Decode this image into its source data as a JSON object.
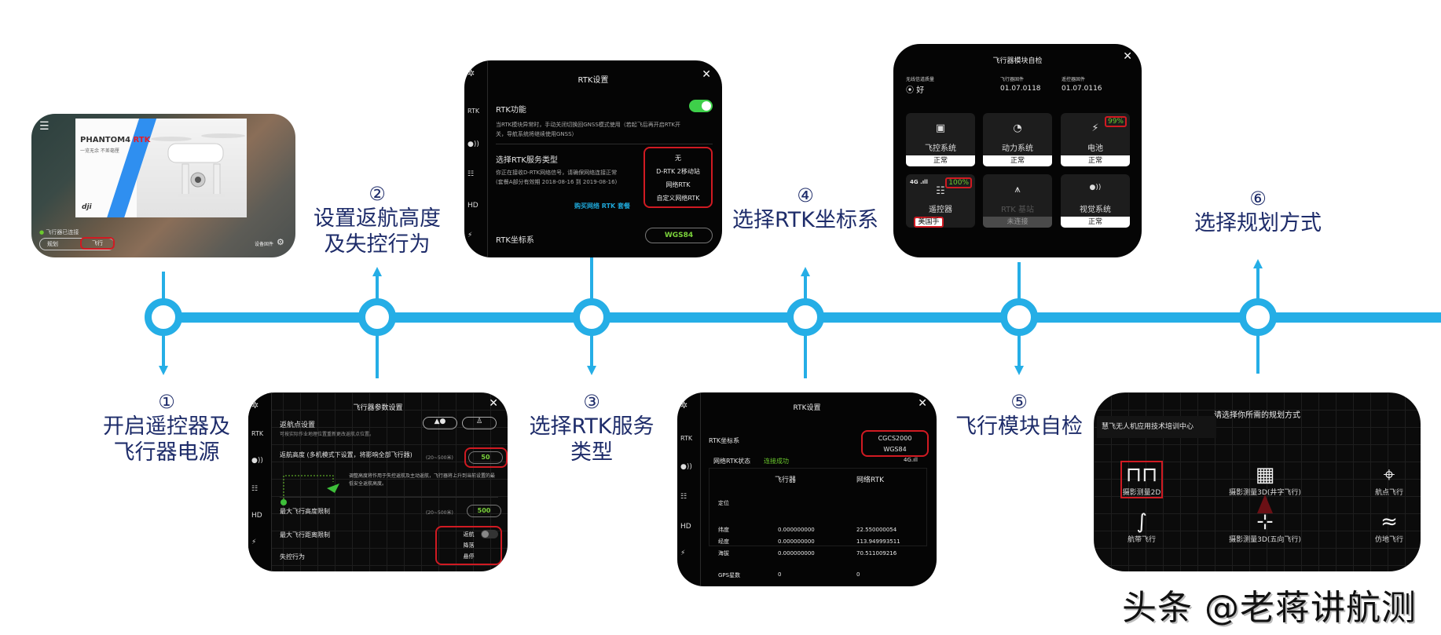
{
  "colors": {
    "timeline": "#25aee6",
    "label": "#1e2c6a",
    "highlight": "#d01a22",
    "accent_green": "#6ccb2d"
  },
  "steps": [
    {
      "num": "①",
      "line1": "开启遥控器及",
      "line2": "飞行器电源"
    },
    {
      "num": "②",
      "line1": "设置返航高度",
      "line2": "及失控行为"
    },
    {
      "num": "③",
      "line1": "选择RTK服务",
      "line2": "类型"
    },
    {
      "num": "④",
      "line1": "选择RTK坐标系",
      "line2": ""
    },
    {
      "num": "⑤",
      "line1": "飞行模块自检",
      "line2": ""
    },
    {
      "num": "⑥",
      "line1": "选择规划方式",
      "line2": ""
    }
  ],
  "screen_start": {
    "menu_icon": "menu-icon",
    "brand": "PHANTOM4",
    "brand_accent": "RTK",
    "slogan": "一览无余 不差毫厘",
    "logo": "dji",
    "status": "飞行器已连接",
    "btn_plan": "规划",
    "btn_fly": "飞行",
    "device_firmware": "设备固件"
  },
  "screen_rtk_service": {
    "title": "RTK设置",
    "close": "✕",
    "side": [
      "RTK",
      "HD"
    ],
    "rtk_function_label": "RTK功能",
    "rtk_function_on": true,
    "rtk_desc": "当RTK模块异常时，手动关闭切换回GNSS模式使用（若起飞后再开启RTK开关，导航系统将继续使用GNSS）",
    "service_type_label": "选择RTK服务类型",
    "service_desc_1": "你正在接收D-RTK网络信号，请确保网络连接正常",
    "service_desc_2": "(套餐A部分有效期 2018-08-16 到 2019-08-16)",
    "buy_link": "购买网络 RTK 套餐",
    "service_options": [
      "无",
      "D-RTK 2移动站",
      "网络RTK",
      "自定义网络RTK"
    ],
    "coord_label": "RTK坐标系",
    "coord_value": "WGS84"
  },
  "screen_params": {
    "title": "飞行器参数设置",
    "close": "✕",
    "side": [
      "RTK",
      "HD"
    ],
    "home_label": "返航点设置",
    "home_desc": "可按实际作业地理位置重新更改返航点位置。",
    "rth_height_label": "返航高度 (多机模式下设置，将影响全部飞行器)",
    "rth_range": "(20~500米)",
    "rth_value": "50",
    "rth_desc": "调整高度将作用于失控返航及主动返航，飞行器将上升到当前设置的最低安全返航高度。",
    "max_alt_label": "最大飞行高度限制",
    "max_alt_range": "(20~500米)",
    "max_alt_value": "500",
    "max_dist_label": "最大飞行距离限制",
    "lost_label": "失控行为",
    "lost_options": [
      "返航",
      "降落",
      "悬停"
    ]
  },
  "screen_rtk_coord": {
    "title": "RTK设置",
    "close": "✕",
    "side": [
      "RTK",
      "HD"
    ],
    "coord_label": "RTK坐标系",
    "coord_options": [
      "CGCS2000",
      "WGS84"
    ],
    "net_status_label": "网络RTK状态",
    "net_status_value": "连接成功",
    "signal": "4G",
    "col_aircraft": "飞行器",
    "col_net": "网络RTK",
    "positioning": "定位",
    "rows": [
      {
        "name": "纬度",
        "aircraft": "0.000000000",
        "net": "22.550000054"
      },
      {
        "name": "经度",
        "aircraft": "0.000000000",
        "net": "113.949993511"
      },
      {
        "name": "海拔",
        "aircraft": "0.000000000",
        "net": "70.511009216"
      },
      {
        "name": "GPS星数",
        "aircraft": "0",
        "net": "0"
      }
    ]
  },
  "screen_selfcheck": {
    "title": "飞行器模块自检",
    "close": "✕",
    "signal_label": "无线信道质量",
    "signal_value": "好",
    "fc_fw_label": "飞行器固件",
    "fc_fw_value": "01.07.0118",
    "rc_fw_label": "遥控器固件",
    "rc_fw_value": "01.07.0116",
    "tiles": [
      {
        "name": "飞控系统",
        "status": "正常",
        "icon": "chip-icon",
        "glyph": "▣"
      },
      {
        "name": "动力系统",
        "status": "正常",
        "icon": "gauge-icon",
        "glyph": "◔"
      },
      {
        "name": "电池",
        "status": "正常",
        "icon": "battery-icon",
        "glyph": "⚡",
        "badge": "99%"
      },
      {
        "name": "遥控器",
        "status": "美国手",
        "icon": "remote-controller-icon",
        "glyph": "☷",
        "badge": "100%",
        "net": "4G"
      },
      {
        "name": "RTK 基站",
        "status": "未连接",
        "icon": "tripod-icon",
        "glyph": "⩚"
      },
      {
        "name": "视觉系统",
        "status": "正常",
        "icon": "vision-icon",
        "glyph": "●))"
      }
    ]
  },
  "screen_plan": {
    "title": "请选择你所需的规划方式",
    "org": "慧飞无人机应用技术培训中心",
    "items": [
      {
        "label": "摄影测量2D",
        "icon": "lawnmower-pattern-icon",
        "glyph": "⊓⊓",
        "selected": true
      },
      {
        "label": "摄影测量3D(井字飞行)",
        "icon": "grid-pattern-icon",
        "glyph": "▦"
      },
      {
        "label": "航点飞行",
        "icon": "waypoint-icon",
        "glyph": "⌖"
      },
      {
        "label": "航带飞行",
        "icon": "strip-flight-icon",
        "glyph": "∫"
      },
      {
        "label": "摄影测量3D(五向飞行)",
        "icon": "five-direction-icon",
        "glyph": "⊹"
      },
      {
        "label": "仿地飞行",
        "icon": "terrain-follow-icon",
        "glyph": "≈"
      }
    ]
  },
  "watermark": "头条 @老蒋讲航测"
}
